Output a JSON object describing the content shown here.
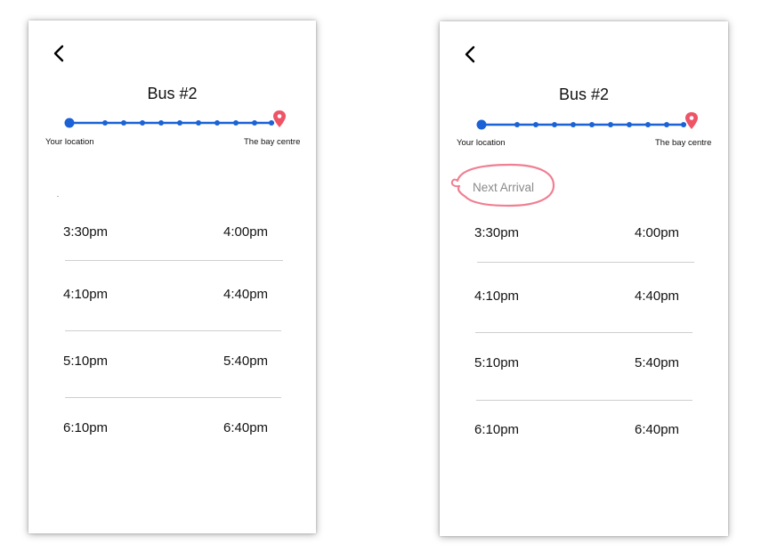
{
  "colors": {
    "route_line": "#1a62d6",
    "destination_pin": "#ef5366",
    "annotation": "#f07f92"
  },
  "icons": {
    "back": "chevron-left-icon",
    "origin": "origin-dot-icon",
    "destination": "map-pin-icon"
  },
  "screens": [
    {
      "title": "Bus #2",
      "origin_label": "Your location",
      "destination_label": "The bay centre",
      "rows": [
        {
          "departure": "3:30pm",
          "arrival": "4:00pm"
        },
        {
          "departure": "4:10pm",
          "arrival": "4:40pm"
        },
        {
          "departure": "5:10pm",
          "arrival": "5:40pm"
        },
        {
          "departure": "6:10pm",
          "arrival": "6:40pm"
        }
      ]
    },
    {
      "title": "Bus #2",
      "origin_label": "Your location",
      "destination_label": "The bay centre",
      "next_arrival_label": "Next Arrival",
      "rows": [
        {
          "departure": "3:30pm",
          "arrival": "4:00pm"
        },
        {
          "departure": "4:10pm",
          "arrival": "4:40pm"
        },
        {
          "departure": "5:10pm",
          "arrival": "5:40pm"
        },
        {
          "departure": "6:10pm",
          "arrival": "6:40pm"
        }
      ]
    }
  ]
}
